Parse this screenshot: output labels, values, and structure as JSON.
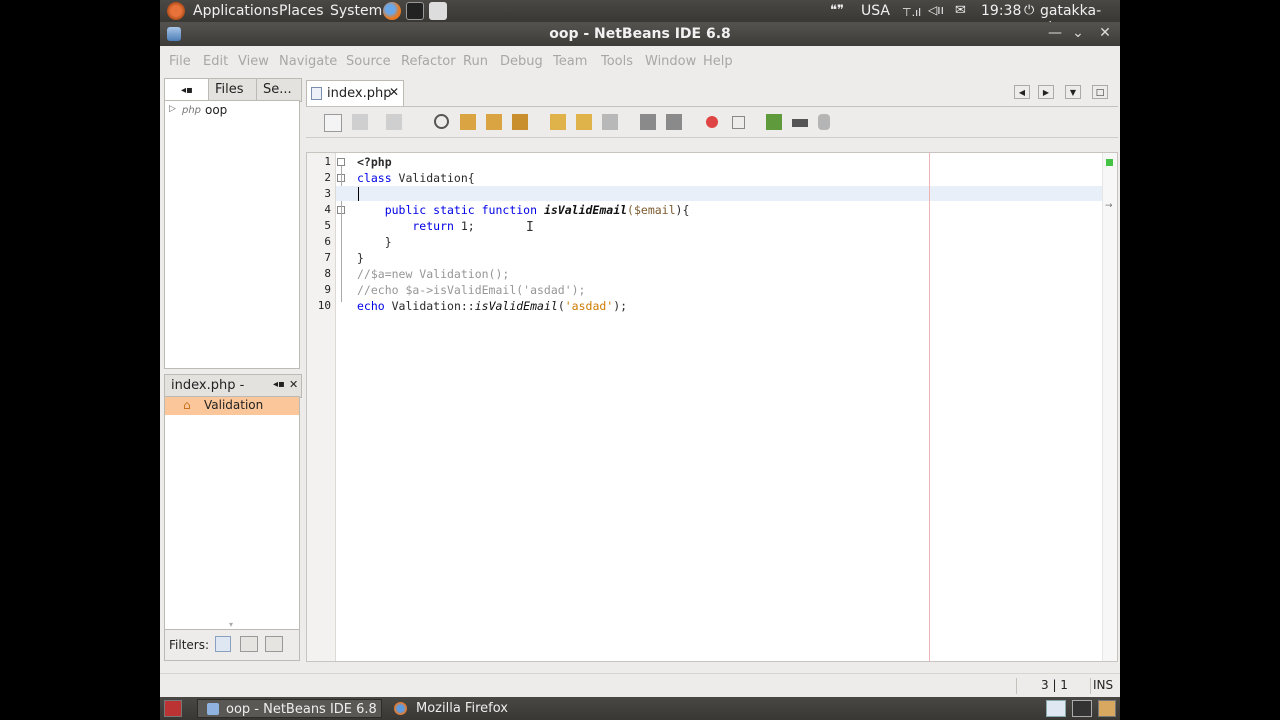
{
  "top_panel": {
    "menus": [
      "Applications",
      "Places",
      "System"
    ],
    "keyboard_layout": "USA",
    "clock": "19:38",
    "user": "gatakka-vtc"
  },
  "window": {
    "title": "oop - NetBeans IDE 6.8"
  },
  "menubar": [
    "File",
    "Edit",
    "View",
    "Navigate",
    "Source",
    "Refactor",
    "Run",
    "Debug",
    "Team",
    "Tools",
    "Window",
    "Help"
  ],
  "projects_panel": {
    "tabs": [
      "Files",
      "Se..."
    ],
    "tree": [
      {
        "label": "oop"
      }
    ]
  },
  "navigator_panel": {
    "title": "index.php - N...",
    "items": [
      "Validation"
    ],
    "filters_label": "Filters:"
  },
  "editor": {
    "tab_label": "index.php",
    "line_numbers": [
      "1",
      "2",
      "3",
      "4",
      "5",
      "6",
      "7",
      "8",
      "9",
      "10"
    ],
    "lines": {
      "l1": "<?php",
      "l2a": "class",
      "l2b": " Validation{",
      "l4a": "    public static function",
      "l4b": "isValidEmail",
      "l4c": "($email",
      "l4d": "){",
      "l5a": "        return",
      "l5b": " 1;",
      "l6": "    }",
      "l7": "}",
      "l8": "//$a=new Validation();",
      "l9": "//echo $a->isValidEmail('asdad');",
      "l10a": "echo",
      "l10b": " Validation::",
      "l10c": "isValidEmail",
      "l10d": "(",
      "l10e": "'asdad'",
      "l10f": ");"
    }
  },
  "statusbar": {
    "position": "3 | 1",
    "mode": "INS"
  },
  "taskbar": {
    "tasks": [
      "oop - NetBeans IDE 6.8",
      "Mozilla Firefox"
    ]
  },
  "colors": {
    "selected_nav_item": "#fbc79a",
    "keyword": "#0000e6",
    "comment": "#969696",
    "string": "#ce7b00"
  }
}
